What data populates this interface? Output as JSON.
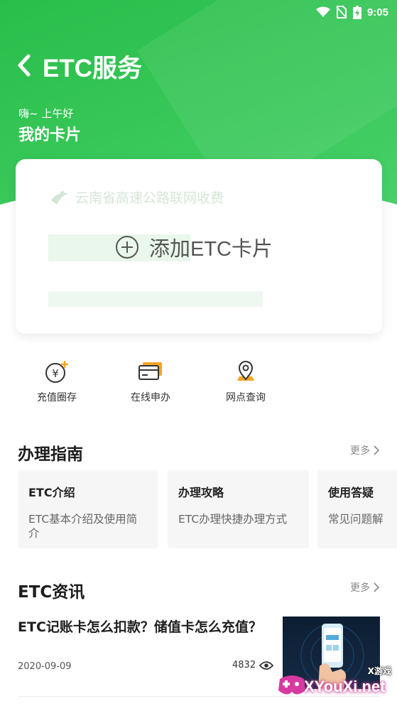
{
  "status_bar": {
    "time": "9:05"
  },
  "header": {
    "title": "ETC服务",
    "greeting": "嗨~ 上午好",
    "subtitle": "我的卡片"
  },
  "card": {
    "bank_name": "云南省高速公路联网收费",
    "add_label": "添加ETC卡片"
  },
  "quick_actions": [
    {
      "label": "充值圈存",
      "icon": "yen-coin-icon"
    },
    {
      "label": "在线申办",
      "icon": "card-icon"
    },
    {
      "label": "网点查询",
      "icon": "location-pin-icon"
    }
  ],
  "guide": {
    "title": "办理指南",
    "more": "更多",
    "items": [
      {
        "title": "ETC介绍",
        "desc": "ETC基本介绍及使用简介"
      },
      {
        "title": "办理攻略",
        "desc": "ETC办理快捷办理方式"
      },
      {
        "title": "使用答疑",
        "desc": "常见问题解"
      }
    ]
  },
  "news": {
    "title": "ETC资讯",
    "more": "更多",
    "items": [
      {
        "title": "ETC记账卡怎么扣款？储值卡怎么充值？",
        "date": "2020-09-09",
        "views": "4832"
      }
    ]
  },
  "watermark": {
    "site": "XYouXi.net",
    "label": "X游戏"
  },
  "colors": {
    "primary_green": "#2fc250",
    "accent_orange": "#f5a623"
  }
}
